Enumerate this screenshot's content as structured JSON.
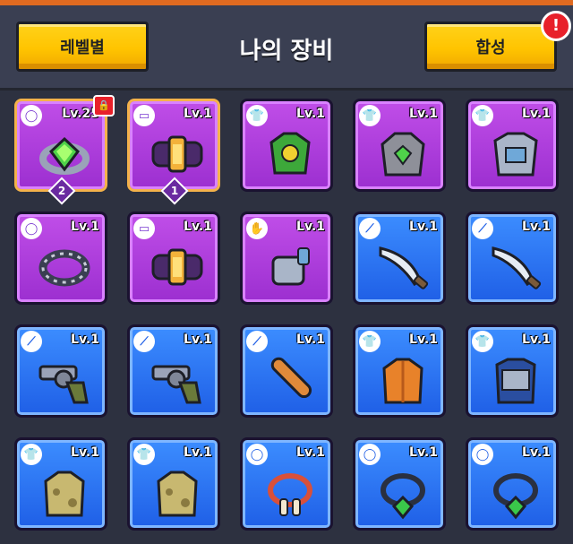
{
  "header": {
    "left_button": "레벨별",
    "title": "나의 장비",
    "right_button": "합성",
    "alert": "!"
  },
  "items": [
    {
      "lv": "Lv.25",
      "color": "purple",
      "slot": "ring",
      "item": "ring-green-gem",
      "equipped": true,
      "count": "2",
      "locked": true
    },
    {
      "lv": "Lv.1",
      "color": "purple",
      "slot": "belt",
      "item": "belt-purple",
      "equipped": true,
      "count": "1",
      "locked": false
    },
    {
      "lv": "Lv.1",
      "color": "purple",
      "slot": "armor",
      "item": "leaf-armor",
      "equipped": false,
      "locked": false
    },
    {
      "lv": "Lv.1",
      "color": "purple",
      "slot": "armor",
      "item": "stone-armor",
      "equipped": false,
      "locked": false
    },
    {
      "lv": "Lv.1",
      "color": "purple",
      "slot": "armor",
      "item": "steel-armor",
      "equipped": false,
      "locked": false
    },
    {
      "lv": "Lv.1",
      "color": "purple",
      "slot": "ring",
      "item": "spiked-collar",
      "equipped": false,
      "locked": false
    },
    {
      "lv": "Lv.1",
      "color": "purple",
      "slot": "belt",
      "item": "belt-purple",
      "equipped": false,
      "locked": false
    },
    {
      "lv": "Lv.1",
      "color": "purple",
      "slot": "glove",
      "item": "robot-gauntlet",
      "equipped": false,
      "locked": false
    },
    {
      "lv": "Lv.1",
      "color": "blue",
      "slot": "weapon",
      "item": "machete",
      "equipped": false,
      "locked": false
    },
    {
      "lv": "Lv.1",
      "color": "blue",
      "slot": "weapon",
      "item": "machete",
      "equipped": false,
      "locked": false
    },
    {
      "lv": "Lv.1",
      "color": "blue",
      "slot": "weapon",
      "item": "revolver",
      "equipped": false,
      "locked": false
    },
    {
      "lv": "Lv.1",
      "color": "blue",
      "slot": "weapon",
      "item": "revolver",
      "equipped": false,
      "locked": false
    },
    {
      "lv": "Lv.1",
      "color": "blue",
      "slot": "weapon",
      "item": "baseball-bat",
      "equipped": false,
      "locked": false
    },
    {
      "lv": "Lv.1",
      "color": "blue",
      "slot": "armor",
      "item": "orange-jacket",
      "equipped": false,
      "locked": false
    },
    {
      "lv": "Lv.1",
      "color": "blue",
      "slot": "armor",
      "item": "tactical-vest",
      "equipped": false,
      "locked": false
    },
    {
      "lv": "Lv.1",
      "color": "blue",
      "slot": "armor",
      "item": "camo-shirt",
      "equipped": false,
      "locked": false
    },
    {
      "lv": "Lv.1",
      "color": "blue",
      "slot": "armor",
      "item": "camo-shirt",
      "equipped": false,
      "locked": false
    },
    {
      "lv": "Lv.1",
      "color": "blue",
      "slot": "ring",
      "item": "bone-necklace",
      "equipped": false,
      "locked": false
    },
    {
      "lv": "Lv.1",
      "color": "blue",
      "slot": "ring",
      "item": "gem-necklace",
      "equipped": false,
      "locked": false
    },
    {
      "lv": "Lv.1",
      "color": "blue",
      "slot": "ring",
      "item": "gem-necklace",
      "equipped": false,
      "locked": false
    }
  ]
}
